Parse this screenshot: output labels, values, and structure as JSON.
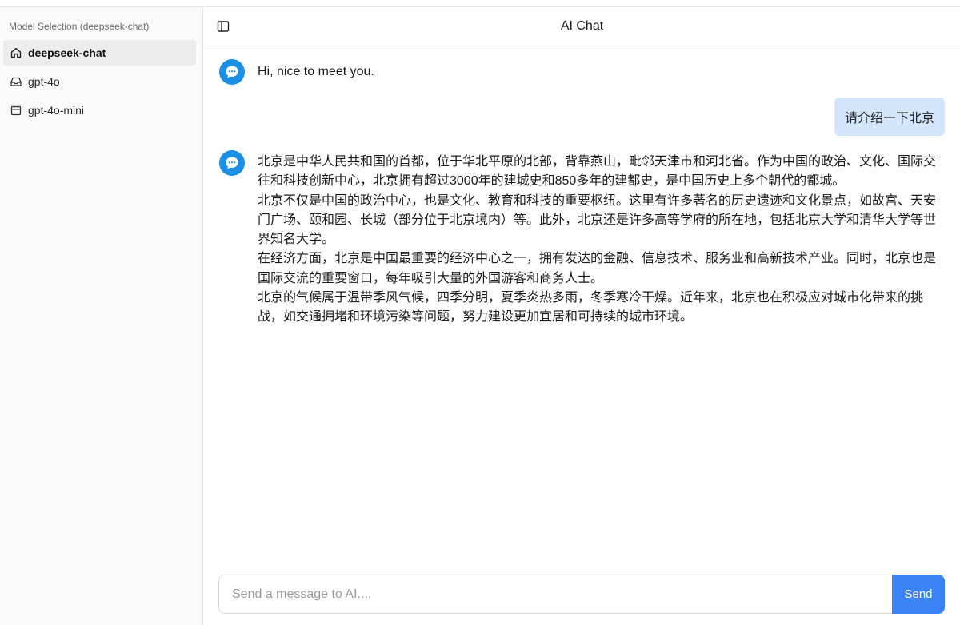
{
  "sidebar": {
    "title": "Model Selection (deepseek-chat)",
    "items": [
      {
        "label": "deepseek-chat",
        "icon": "home-icon",
        "active": true
      },
      {
        "label": "gpt-4o",
        "icon": "inbox-icon",
        "active": false
      },
      {
        "label": "gpt-4o-mini",
        "icon": "calendar-icon",
        "active": false
      }
    ]
  },
  "header": {
    "title": "AI Chat",
    "toggle_icon": "sidebar-toggle-icon"
  },
  "messages": [
    {
      "role": "ai",
      "avatar_icon": "chat-bubble-icon",
      "text": "Hi, nice to meet you."
    },
    {
      "role": "user",
      "text": "请介绍一下北京"
    },
    {
      "role": "ai",
      "avatar_icon": "chat-bubble-icon",
      "paragraphs": [
        "北京是中华人民共和国的首都，位于华北平原的北部，背靠燕山，毗邻天津市和河北省。作为中国的政治、文化、国际交往和科技创新中心，北京拥有超过3000年的建城史和850多年的建都史，是中国历史上多个朝代的都城。",
        "北京不仅是中国的政治中心，也是文化、教育和科技的重要枢纽。这里有许多著名的历史遗迹和文化景点，如故宫、天安门广场、颐和园、长城（部分位于北京境内）等。此外，北京还是许多高等学府的所在地，包括北京大学和清华大学等世界知名大学。",
        "在经济方面，北京是中国最重要的经济中心之一，拥有发达的金融、信息技术、服务业和高新技术产业。同时，北京也是国际交流的重要窗口，每年吸引大量的外国游客和商务人士。",
        "北京的气候属于温带季风气候，四季分明，夏季炎热多雨，冬季寒冷干燥。近年来，北京也在积极应对城市化带来的挑战，如交通拥堵和环境污染等问题，努力建设更加宜居和可持续的城市环境。"
      ]
    }
  ],
  "composer": {
    "placeholder": "Send a message to AI....",
    "value": "",
    "send_label": "Send"
  },
  "colors": {
    "accent": "#3b82f6",
    "avatar": "#1a8fe3",
    "user_bubble": "#d3e5fb",
    "sidebar_active": "#ececec"
  }
}
